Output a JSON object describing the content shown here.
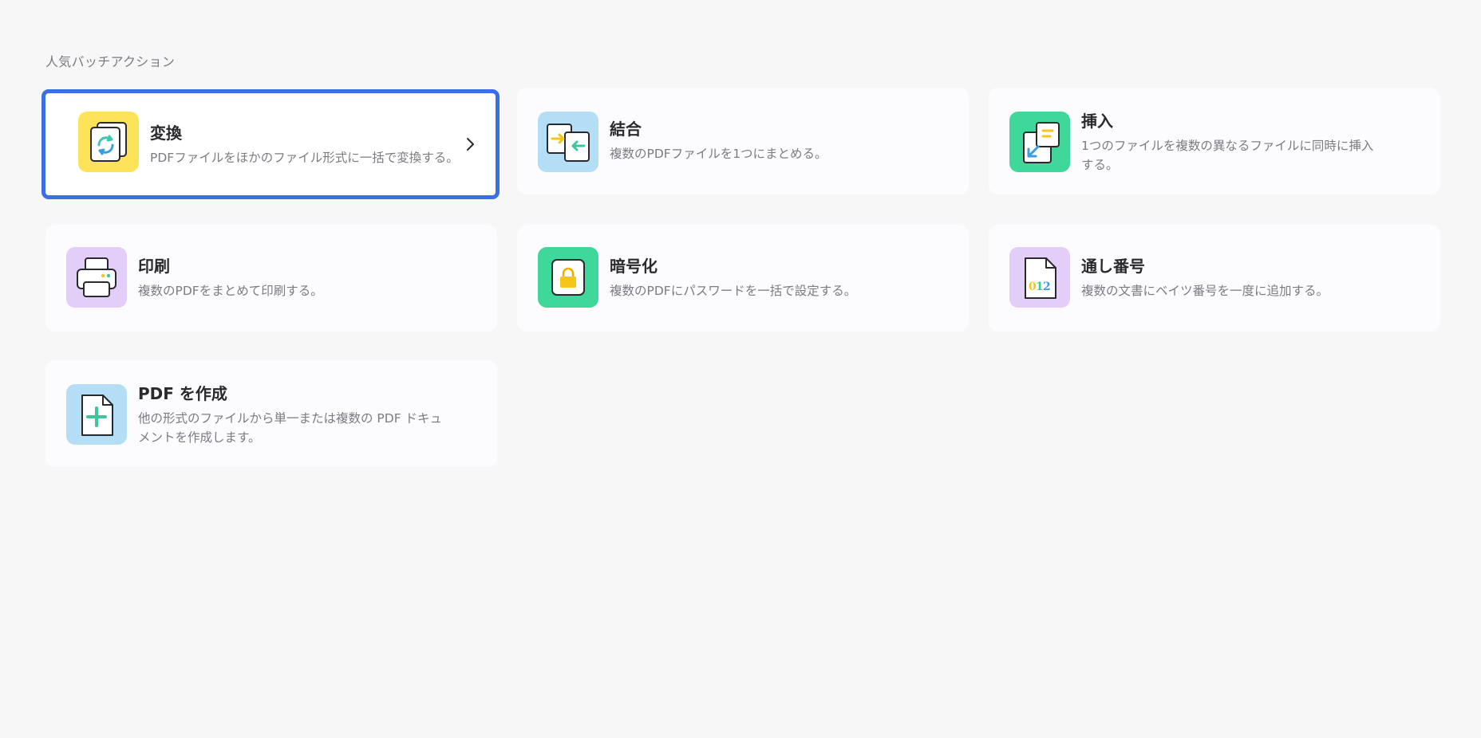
{
  "section": {
    "title": "人気バッチアクション"
  },
  "cards": [
    {
      "id": "convert",
      "title": "変換",
      "desc": "PDFファイルをほかのファイル形式に一括で変換する。",
      "icon": "convert-icon",
      "tile_color": "#fde35a",
      "selected": true
    },
    {
      "id": "combine",
      "title": "結合",
      "desc": "複数のPDFファイルを1つにまとめる。",
      "icon": "combine-icon",
      "tile_color": "#b3def5"
    },
    {
      "id": "insert",
      "title": "挿入",
      "desc": "1つのファイルを複数の異なるファイルに同時に挿入する。",
      "icon": "insert-icon",
      "tile_color": "#3fd89a"
    },
    {
      "id": "print",
      "title": "印刷",
      "desc": "複数のPDFをまとめて印刷する。",
      "icon": "printer-icon",
      "tile_color": "#e3cdf9"
    },
    {
      "id": "encrypt",
      "title": "暗号化",
      "desc": "複数のPDFにパスワードを一括で設定する。",
      "icon": "lock-icon",
      "tile_color": "#3fd89a"
    },
    {
      "id": "bates",
      "title": "通し番号",
      "desc": "複数の文書にベイツ番号を一度に追加する。",
      "icon": "bates-number-icon",
      "tile_color": "#e3cdf9",
      "icon_text": "012"
    },
    {
      "id": "create",
      "title": "PDF を作成",
      "desc": "他の形式のファイルから単一または複数の PDF ドキュメントを作成します。",
      "icon": "create-pdf-icon",
      "tile_color": "#b3def5"
    }
  ]
}
